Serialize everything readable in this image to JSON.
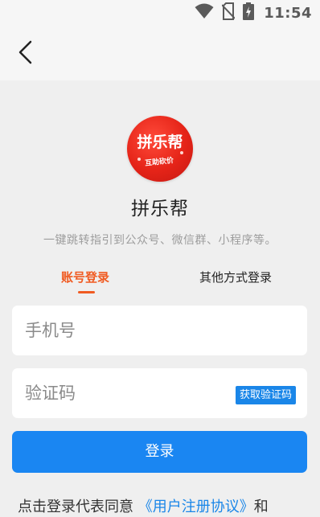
{
  "status_bar": {
    "time": "11:54",
    "icons": [
      "wifi-icon",
      "no-sim-icon",
      "battery-charging-icon"
    ]
  },
  "app_bar": {
    "back_icon": "chevron-left-icon"
  },
  "logo": {
    "main_text": "拼乐帮",
    "sub_text": "互助砍价",
    "background_color": "#e52418"
  },
  "app": {
    "name": "拼乐帮",
    "description": "一键跳转指引到公众号、微信群、小程序等。"
  },
  "tabs": [
    {
      "label": "账号登录",
      "active": true
    },
    {
      "label": "其他方式登录",
      "active": false
    }
  ],
  "form": {
    "phone_placeholder": "手机号",
    "code_placeholder": "验证码",
    "get_code_label": "获取验证码",
    "login_label": "登录"
  },
  "agreement": {
    "prefix": "点击登录代表同意",
    "link_text": "《用户注册协议》",
    "suffix": "和"
  },
  "colors": {
    "accent_orange": "#f05b22",
    "primary_blue": "#1a86f2",
    "page_background": "#efefef"
  }
}
